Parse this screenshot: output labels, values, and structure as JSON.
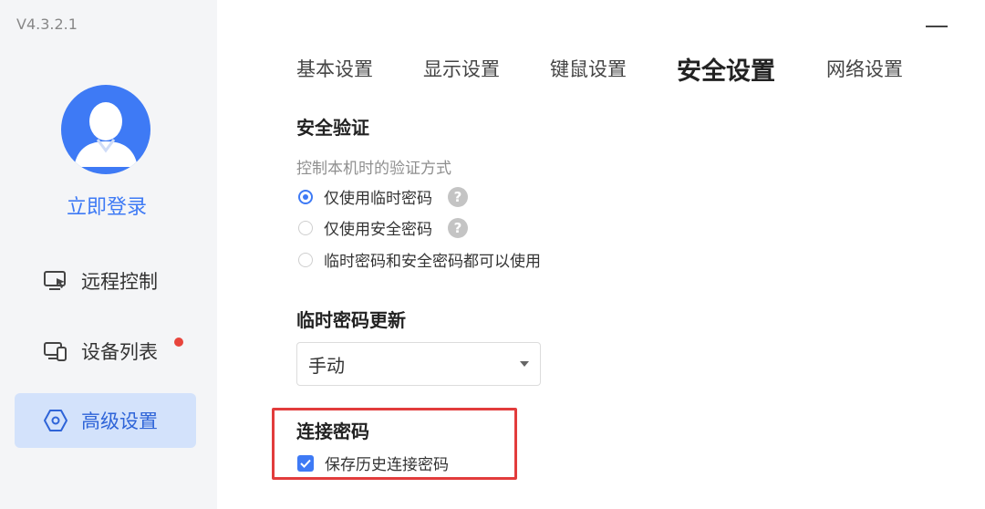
{
  "app": {
    "version": "V4.3.2.1"
  },
  "sidebar": {
    "login_label": "立即登录",
    "items": [
      {
        "label": "远程控制",
        "icon": "remote-screen-icon"
      },
      {
        "label": "设备列表",
        "icon": "devices-icon",
        "has_badge": true
      },
      {
        "label": "高级设置",
        "icon": "settings-hex-icon",
        "active": true
      }
    ]
  },
  "tabs": [
    {
      "label": "基本设置"
    },
    {
      "label": "显示设置"
    },
    {
      "label": "键鼠设置"
    },
    {
      "label": "安全设置",
      "active": true
    },
    {
      "label": "网络设置"
    }
  ],
  "security": {
    "title": "安全验证",
    "description": "控制本机时的验证方式",
    "options": [
      {
        "label": "仅使用临时密码",
        "checked": true,
        "help": "?"
      },
      {
        "label": "仅使用安全密码",
        "checked": false,
        "help": "?"
      },
      {
        "label": "临时密码和安全密码都可以使用",
        "checked": false
      }
    ]
  },
  "temp_password_update": {
    "title": "临时密码更新",
    "selected": "手动"
  },
  "connection_password": {
    "title": "连接密码",
    "checkbox_label": "保存历史连接密码",
    "checked": true
  },
  "colors": {
    "accent": "#3e7af5",
    "badge": "#e8453c",
    "highlight_border": "#e23c3c",
    "sidebar_bg": "#f4f5f7",
    "active_nav_bg": "#d3e2fb"
  }
}
